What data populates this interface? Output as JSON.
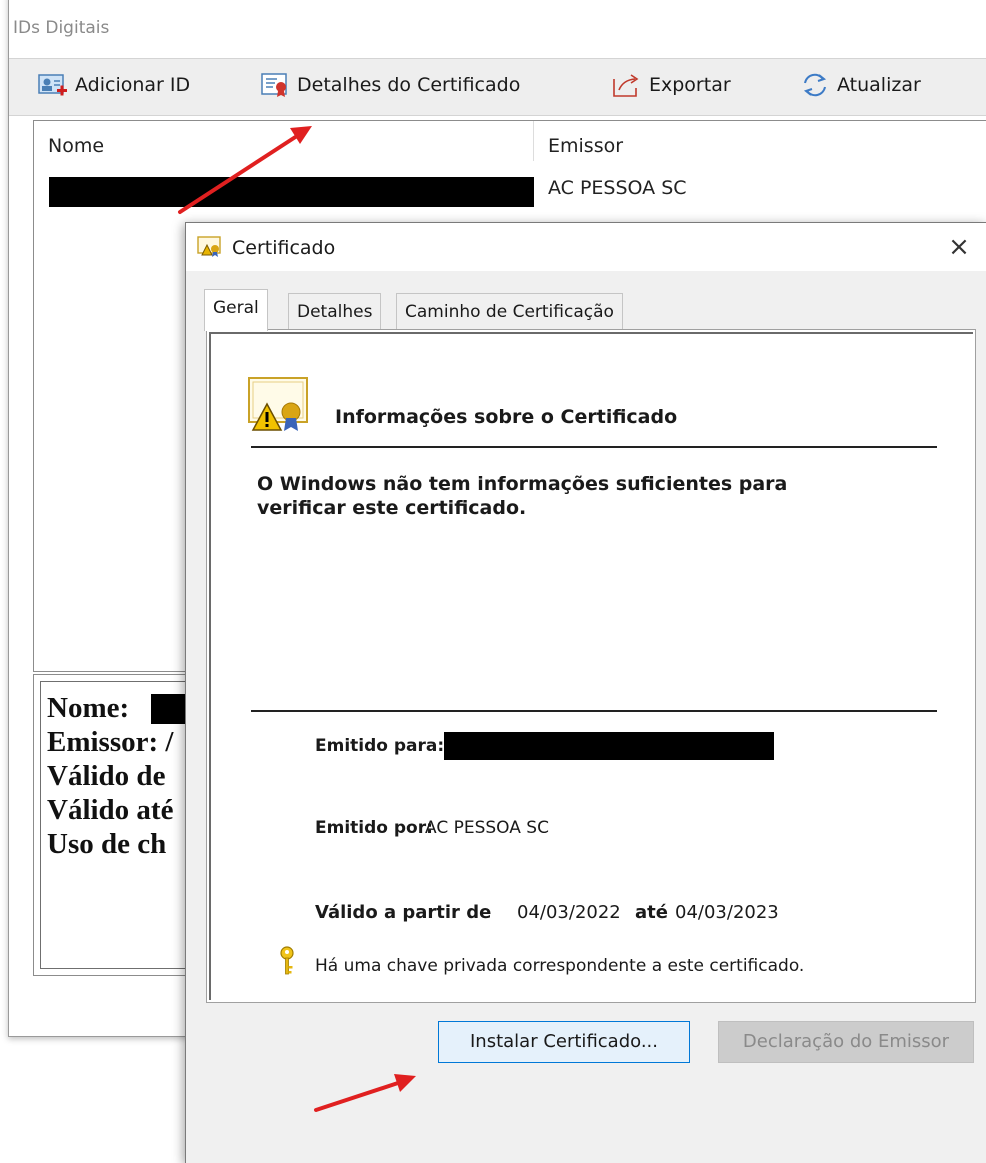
{
  "ids_window": {
    "title": "IDs Digitais",
    "toolbar": {
      "add_id": "Adicionar ID",
      "cert_details": "Detalhes do Certificado",
      "export": "Exportar",
      "refresh": "Atualizar"
    },
    "list": {
      "col_name": "Nome",
      "col_issuer": "Emissor",
      "rows": [
        {
          "issuer": "AC PESSOA SC"
        }
      ]
    },
    "details": {
      "lines": [
        "Nome:",
        "Emissor: /",
        "Válido de",
        "Válido até",
        "Uso de ch"
      ]
    }
  },
  "cert_dialog": {
    "title": "Certificado",
    "close": "×",
    "tabs": [
      "Geral",
      "Detalhes",
      "Caminho de Certificação"
    ],
    "active_tab": "Geral",
    "heading": "Informações sobre o Certificado",
    "warning": "O Windows não tem informações suficientes para verificar este certificado.",
    "issued_to_label": "Emitido para:",
    "issued_by_label": "Emitido por:",
    "issued_by_value": "AC PESSOA SC",
    "valid_from_label": "Válido a partir de",
    "valid_from_value": "04/03/2022",
    "valid_to_label": "até",
    "valid_to_value": "04/03/2023",
    "key_note": "Há uma chave privada correspondente a este certificado.",
    "buttons": {
      "install": "Instalar Certificado...",
      "issuer_statement": "Declaração do Emissor"
    }
  },
  "colors": {
    "accent": "#0078d7",
    "arrow": "#e02020",
    "redaction": "#000000"
  }
}
